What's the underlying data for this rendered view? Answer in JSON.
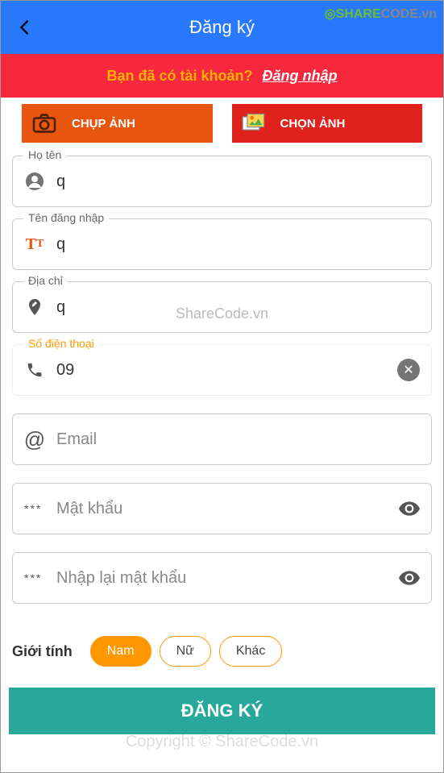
{
  "header": {
    "title": "Đăng ký",
    "logo_part1": "SHARE",
    "logo_part2": "CODE",
    "logo_part3": ".vn"
  },
  "login_banner": {
    "prompt": "Bạn đã có tài khoản?",
    "link": "Đăng nhập"
  },
  "photo_buttons": {
    "capture": "CHỤP ẢNH",
    "choose": "CHỌN ẢNH"
  },
  "fields": {
    "fullname": {
      "label": "Họ tên",
      "value": "q"
    },
    "username": {
      "label": "Tên đăng nhập",
      "value": "q"
    },
    "address": {
      "label": "Địa chỉ",
      "value": "q"
    },
    "phone": {
      "label": "Số điện thoại",
      "value": "09"
    },
    "email": {
      "placeholder": "Email",
      "value": ""
    },
    "password": {
      "placeholder": "Mật khẩu",
      "value": ""
    },
    "confirm_password": {
      "placeholder": "Nhập lại mật khẩu",
      "value": ""
    }
  },
  "gender": {
    "label": "Giới tính",
    "options": [
      "Nam",
      "Nữ",
      "Khác"
    ],
    "selected": "Nam"
  },
  "submit": "ĐĂNG KÝ",
  "watermarks": {
    "center": "ShareCode.vn",
    "bottom": "Copyright © ShareCode.vn"
  }
}
